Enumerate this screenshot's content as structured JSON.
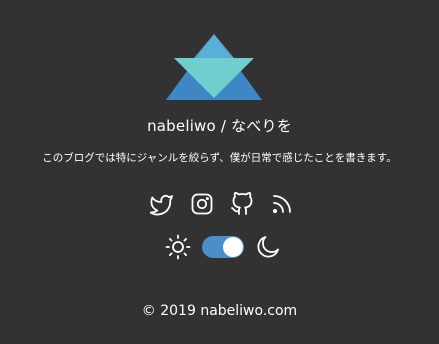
{
  "brand": {
    "logo_icon": "triangle-logo-icon",
    "colors": {
      "background": "#323232",
      "logo_light": "#6fcfcf",
      "logo_dark": "#3f86c4",
      "toggle": "#4a8fc9"
    }
  },
  "header": {
    "title": "nabeliwo / なべりを",
    "tagline": "このブログでは特にジャンルを絞らず、僕が日常で感じたことを書きます。"
  },
  "social": [
    {
      "icon": "twitter-icon"
    },
    {
      "icon": "instagram-icon"
    },
    {
      "icon": "github-icon"
    },
    {
      "icon": "rss-icon"
    }
  ],
  "theme_switch": {
    "light_icon": "sun-icon",
    "dark_icon": "moon-icon",
    "state": "dark"
  },
  "footer": {
    "copyright": "© 2019 nabeliwo.com"
  }
}
